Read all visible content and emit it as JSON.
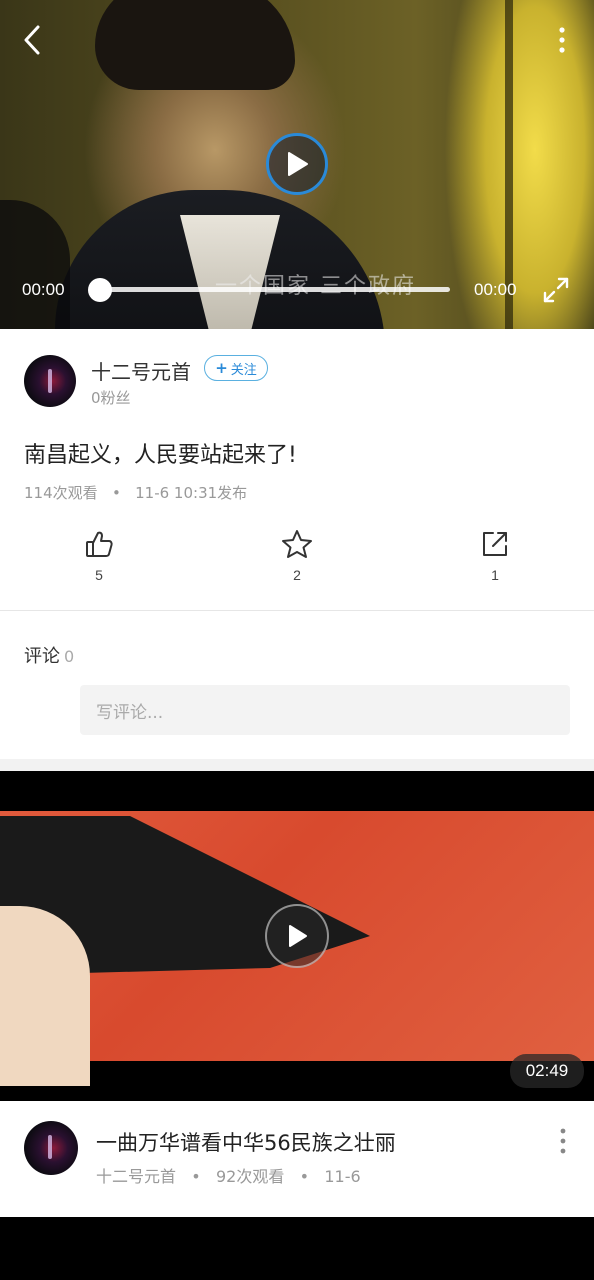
{
  "player": {
    "subtitle_overlay": "一个国家 三个政府",
    "current_time": "00:00",
    "duration_time": "00:00",
    "progress": 0
  },
  "author": {
    "name": "十二号元首",
    "follow_label": "关注",
    "fans": "0粉丝"
  },
  "video": {
    "title": "南昌起义，人民要站起来了!",
    "views": "114次观看",
    "published": "11-6 10:31发布"
  },
  "actions": {
    "like_count": "5",
    "favorite_count": "2",
    "share_count": "1"
  },
  "comments": {
    "title": "评论",
    "count": "0",
    "placeholder": "写评论..."
  },
  "recommended": {
    "title": "一曲万华谱看中华56民族之壮丽",
    "author": "十二号元首",
    "views": "92次观看",
    "date": "11-6",
    "duration": "02:49"
  },
  "icons": {
    "back": "back-arrow-icon",
    "more": "more-vertical-icon",
    "play": "play-icon",
    "fullscreen": "fullscreen-icon",
    "like": "thumbs-up-icon",
    "favorite": "star-icon",
    "share": "share-icon"
  },
  "colors": {
    "accent": "#2a8ad8",
    "muted_text": "#999999"
  }
}
